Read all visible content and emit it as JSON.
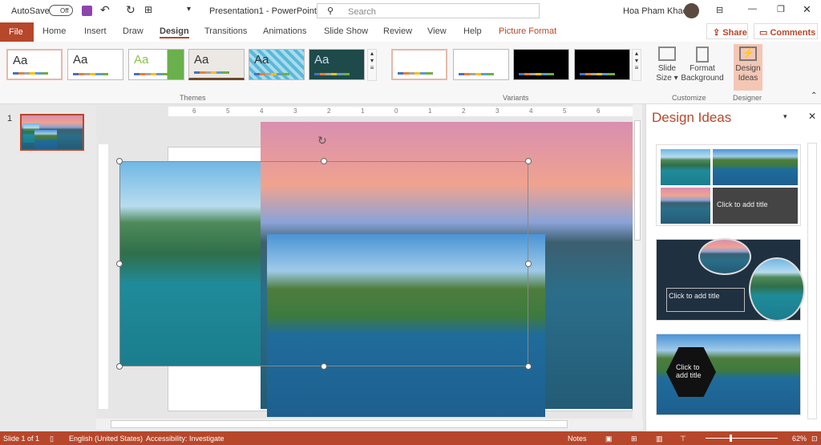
{
  "titlebar": {
    "autosave": "AutoSave",
    "toggle": "Off",
    "doc_title": "Presentation1  -  PowerPoint",
    "search_placeholder": "Search",
    "user": "Hoa Pham Khac"
  },
  "tabs": [
    "File",
    "Home",
    "Insert",
    "Draw",
    "Design",
    "Transitions",
    "Animations",
    "Slide Show",
    "Review",
    "View",
    "Help",
    "Picture Format"
  ],
  "active_tab": "Design",
  "share": "Share",
  "comments": "Comments",
  "ribbon": {
    "theme_label": "Aa",
    "groups": {
      "themes": "Themes",
      "variants": "Variants",
      "customize": "Customize",
      "designer": "Designer"
    },
    "slide_size": "Slide Size",
    "format_background": "Format Background",
    "design_ideas": "Design Ideas"
  },
  "thumbs": {
    "slide_number": "1"
  },
  "ruler": [
    "6",
    "5",
    "4",
    "3",
    "2",
    "1",
    "0",
    "1",
    "2",
    "3",
    "4",
    "5",
    "6"
  ],
  "design_pane": {
    "title": "Design Ideas",
    "cards": [
      {
        "title": "Click to add title"
      },
      {
        "title": "Click to add title"
      },
      {
        "title": "Click to add title"
      }
    ]
  },
  "status": {
    "slide": "Slide 1 of 1",
    "language": "English (United States)",
    "accessibility": "Accessibility: Investigate",
    "notes": "Notes",
    "zoom": "62%"
  },
  "colors": {
    "accent": "#b7472a",
    "picture_format": "#b7472a"
  }
}
